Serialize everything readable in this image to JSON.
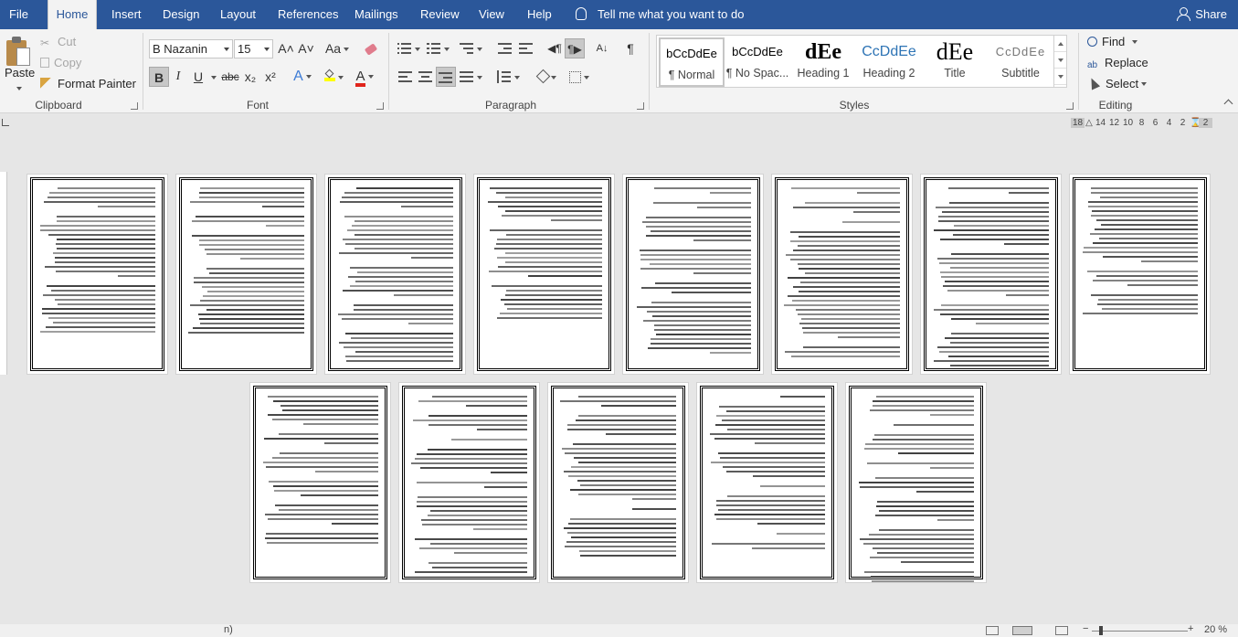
{
  "tabs": [
    {
      "label": "File",
      "active": false
    },
    {
      "label": "Home",
      "active": true
    },
    {
      "label": "Insert",
      "active": false
    },
    {
      "label": "Design",
      "active": false
    },
    {
      "label": "Layout",
      "active": false
    },
    {
      "label": "References",
      "active": false
    },
    {
      "label": "Mailings",
      "active": false
    },
    {
      "label": "Review",
      "active": false
    },
    {
      "label": "View",
      "active": false
    },
    {
      "label": "Help",
      "active": false
    }
  ],
  "tell_me": "Tell me what you want to do",
  "share": "Share",
  "clipboard": {
    "paste": "Paste",
    "cut": "Cut",
    "copy": "Copy",
    "format_painter": "Format Painter",
    "label": "Clipboard"
  },
  "font": {
    "name": "B Nazanin",
    "size": "15",
    "label": "Font",
    "bold": "B",
    "italic": "I",
    "underline": "U",
    "strike": "abc",
    "subscript": "x₂",
    "superscript": "x²",
    "grow": "A˄",
    "shrink": "A˅",
    "change_case": "Aa",
    "effects": "A",
    "color_letter": "A"
  },
  "paragraph": {
    "label": "Paragraph",
    "pilcrow": "¶"
  },
  "styles": {
    "label": "Styles",
    "items": [
      {
        "preview": "bCcDdEe",
        "name": "¶ Normal"
      },
      {
        "preview": "bCcDdEe",
        "name": "¶ No Spac..."
      },
      {
        "preview": "dEe",
        "name": "Heading 1"
      },
      {
        "preview": "CcDdEe",
        "name": "Heading 2"
      },
      {
        "preview": "dEe",
        "name": "Title"
      },
      {
        "preview": "CcDdEe",
        "name": "Subtitle"
      }
    ]
  },
  "editing": {
    "find": "Find",
    "replace": "Replace",
    "select": "Select",
    "label": "Editing",
    "replace_icon_text": "ab"
  },
  "ruler": [
    "18",
    "14",
    "12",
    "10",
    "8",
    "6",
    "4",
    "2",
    "2"
  ],
  "pages": [
    {
      "row": 1,
      "index": 1
    },
    {
      "row": 1,
      "index": 2
    },
    {
      "row": 1,
      "index": 3
    },
    {
      "row": 1,
      "index": 4
    },
    {
      "row": 1,
      "index": 5
    },
    {
      "row": 1,
      "index": 6
    },
    {
      "row": 1,
      "index": 7
    },
    {
      "row": 1,
      "index": 8
    },
    {
      "row": 2,
      "index": 9
    },
    {
      "row": 2,
      "index": 10
    },
    {
      "row": 2,
      "index": 11
    },
    {
      "row": 2,
      "index": 12
    },
    {
      "row": 2,
      "index": 13
    }
  ],
  "status": {
    "fragment": "n)",
    "zoom": "20 %"
  }
}
